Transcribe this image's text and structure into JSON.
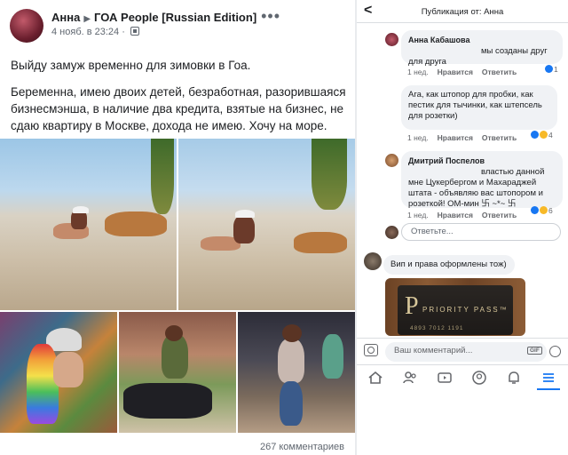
{
  "post": {
    "author": "Анна",
    "group": "ГОА People [Russian Edition]",
    "timestamp": "4 нояб. в 23:24",
    "paragraph_1": "Выйду замуж временно для зимовки в Гоа.",
    "paragraph_2": "Беременна, имею двоих детей, безработная, разорившаяся бизнесмэнша, в наличие два кредита, взятые на бизнес, не сдаю квартиру в Москве, дохода не имею. Хочу на море.",
    "comment_count": "267 комментариев"
  },
  "mobile": {
    "title": "Публикация от: Анна",
    "comments": [
      {
        "author": "Анна Кабашова",
        "text_tail": "мы созданы друг для друга",
        "time": "1 нед.",
        "like": "Нравится",
        "reply": "Ответить",
        "reactions": "1"
      },
      {
        "text": "Ага, как штопор для пробки, как пестик для тычинки, как штепсель для розетки)",
        "time": "1 нед.",
        "like": "Нравится",
        "reply": "Ответить",
        "reactions": "4"
      },
      {
        "author": "Дмитрий Поспелов",
        "text_tail": "властью данной мне Цукербергом и Махараджей штата - объявляю вас штопором и розеткой! ОМ-мин 卐 ~*~ 卐",
        "time": "1 нед.",
        "like": "Нравится",
        "reply": "Ответить",
        "reactions": "6"
      }
    ],
    "reply_placeholder": "Ответьте...",
    "partial_comment": "Вип и права оформлены тож)",
    "priority_pass": {
      "logo": "P",
      "label": "PRIORITY PASS™",
      "code": "4893 7012 1191"
    },
    "composer_placeholder": "Ваш комментарий...",
    "gif_label": "GIF",
    "colors": {
      "accent": "#1877f2",
      "bubble": "#f0f2f5"
    }
  }
}
